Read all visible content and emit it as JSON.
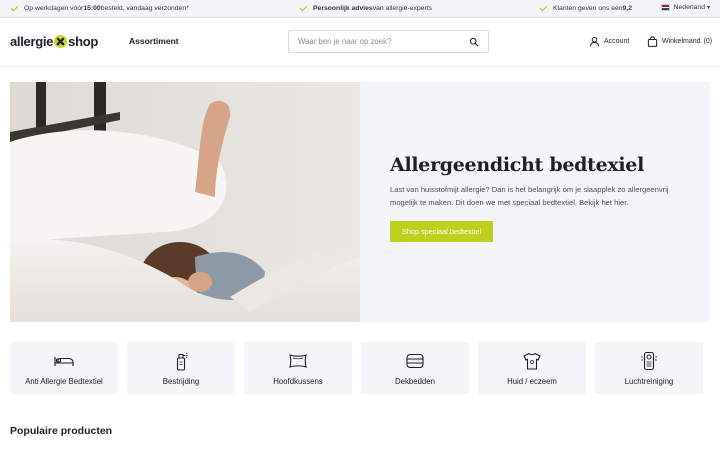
{
  "topbar": {
    "usp1": {
      "pre": "Op werkdagen vóór ",
      "bold": "15:00",
      "post": " besteld, vandaag verzonden*"
    },
    "usp2": {
      "bold": "Persoonlijk advies",
      "post": " van allergie-experts"
    },
    "usp3": {
      "pre": "Klanten geven ons een ",
      "bold": "9,2"
    },
    "language": "Nederland",
    "language_caret": "▾",
    "check_color": "#bfcf1d"
  },
  "header": {
    "logo_left": "allergie",
    "logo_right": "shop",
    "nav_item": "Assortiment",
    "search_placeholder": "Waar ben je naar op zoek?",
    "account_label": "Account",
    "cart_label": "Winkelmand",
    "cart_count": "(0)"
  },
  "hero": {
    "title": "Allergeendicht bedtexiel",
    "description": "Last van huisstofmijt allergie? Dan is het belangrijk om je slaapplek zo allergeenvrij mogelijk te maken. Dit doen we met speciaal bedtextiel. Bekijk het hier.",
    "button_label": "Shop speciaal bedtextiel",
    "button_color": "#bfcf1d"
  },
  "categories": [
    {
      "label": "Anti Allergie Bedtextiel",
      "icon": "bed-icon"
    },
    {
      "label": "Bestrijding",
      "icon": "spray-icon"
    },
    {
      "label": "Hoofdkussens",
      "icon": "pillow-icon"
    },
    {
      "label": "Dekbedden",
      "icon": "duvet-icon"
    },
    {
      "label": "Huid / eczeem",
      "icon": "tshirt-icon"
    },
    {
      "label": "Luchtreiniging",
      "icon": "air-purifier-icon"
    }
  ],
  "popular": {
    "title": "Populaire producten"
  }
}
